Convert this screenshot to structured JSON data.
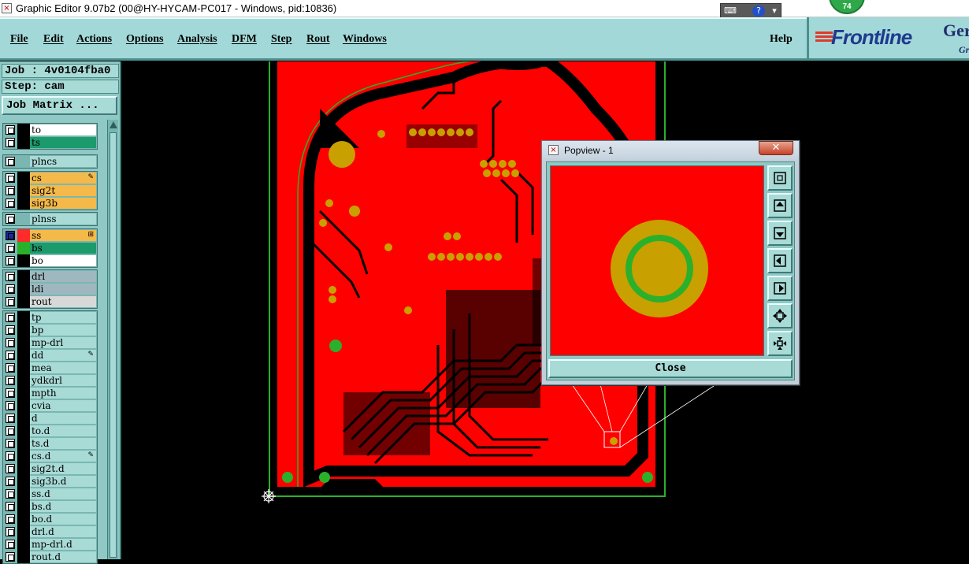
{
  "window": {
    "title": "Graphic Editor 9.07b2 (00@HY-HYCAM-PC017 - Windows, pid:10836)",
    "app_icon": "x-app-icon",
    "tray_icons": [
      "keyboard-icon",
      "help-icon",
      "dropdown-icon"
    ],
    "badge": "74"
  },
  "menu": {
    "items": [
      "File",
      "Edit",
      "Actions",
      "Options",
      "Analysis",
      "DFM",
      "Step",
      "Rout",
      "Windows"
    ],
    "help": "Help"
  },
  "logo": {
    "brand": "Frontline",
    "suffix_top": "Ger",
    "suffix_bottom": "Gr"
  },
  "job": {
    "job_label": "Job : 4v0104fba0",
    "step_label": "Step: cam",
    "matrix_button": "Job Matrix ..."
  },
  "layer_groups": [
    {
      "layers": [
        {
          "name": "to",
          "color": "#ffffff",
          "swatch": "#000000"
        },
        {
          "name": "ts",
          "color": "#1b9b6b",
          "swatch": "#000000"
        }
      ]
    },
    {
      "layers": [
        {
          "name": "plncs",
          "color": "#a8dad6",
          "swatch": "#7ab7b2"
        }
      ]
    },
    {
      "layers": [
        {
          "name": "cs",
          "color": "#f5b94a",
          "swatch": "#000000",
          "mark": "✎"
        },
        {
          "name": "sig2t",
          "color": "#f5b94a",
          "swatch": "#000000"
        },
        {
          "name": "sig3b",
          "color": "#f5b94a",
          "swatch": "#000000"
        }
      ]
    },
    {
      "layers": [
        {
          "name": "plnss",
          "color": "#a8dad6",
          "swatch": "#7ab7b2"
        }
      ]
    },
    {
      "layers": [
        {
          "name": "ss",
          "color": "#f5b94a",
          "swatch": "#ff2a2a",
          "mark": "⊞",
          "active": true
        },
        {
          "name": "bs",
          "color": "#1b9b6b",
          "swatch": "#2bb02b"
        },
        {
          "name": "bo",
          "color": "#ffffff",
          "swatch": "#000000"
        }
      ]
    },
    {
      "layers": [
        {
          "name": "drl",
          "color": "#9fb8c0",
          "swatch": "#000000"
        },
        {
          "name": "ldi",
          "color": "#9fb8c0",
          "swatch": "#000000"
        },
        {
          "name": "rout",
          "color": "#d8d8d8",
          "swatch": "#000000"
        }
      ]
    },
    {
      "layers": [
        {
          "name": "tp",
          "color": "#a8dad6",
          "swatch": "#000000"
        },
        {
          "name": "bp",
          "color": "#a8dad6",
          "swatch": "#000000"
        },
        {
          "name": "mp-drl",
          "color": "#a8dad6",
          "swatch": "#000000"
        },
        {
          "name": "dd",
          "color": "#a8dad6",
          "swatch": "#000000",
          "mark": "✎"
        },
        {
          "name": "mea",
          "color": "#a8dad6",
          "swatch": "#000000"
        },
        {
          "name": "ydkdrl",
          "color": "#a8dad6",
          "swatch": "#000000"
        },
        {
          "name": "mpth",
          "color": "#a8dad6",
          "swatch": "#000000"
        },
        {
          "name": "cvia",
          "color": "#a8dad6",
          "swatch": "#000000"
        },
        {
          "name": "d",
          "color": "#a8dad6",
          "swatch": "#000000"
        },
        {
          "name": "to.d",
          "color": "#a8dad6",
          "swatch": "#000000"
        },
        {
          "name": "ts.d",
          "color": "#a8dad6",
          "swatch": "#000000"
        },
        {
          "name": "cs.d",
          "color": "#a8dad6",
          "swatch": "#000000",
          "mark": "✎"
        },
        {
          "name": "sig2t.d",
          "color": "#a8dad6",
          "swatch": "#000000"
        },
        {
          "name": "sig3b.d",
          "color": "#a8dad6",
          "swatch": "#000000"
        },
        {
          "name": "ss.d",
          "color": "#a8dad6",
          "swatch": "#000000"
        },
        {
          "name": "bs.d",
          "color": "#a8dad6",
          "swatch": "#000000"
        },
        {
          "name": "bo.d",
          "color": "#a8dad6",
          "swatch": "#000000"
        },
        {
          "name": "drl.d",
          "color": "#a8dad6",
          "swatch": "#000000"
        },
        {
          "name": "mp-drl.d",
          "color": "#a8dad6",
          "swatch": "#000000"
        },
        {
          "name": "rout.d",
          "color": "#a8dad6",
          "swatch": "#000000"
        }
      ]
    }
  ],
  "board_colors": {
    "copper": "#ff0000",
    "outline": "#2bb02b",
    "pad": "#c8a000",
    "background": "#000000"
  },
  "popview": {
    "title": "Popview - 1",
    "close_glyph": "✕",
    "close_button": "Close",
    "tools": [
      "zoom-fit-icon",
      "pan-up-icon",
      "pan-down-icon",
      "pan-left-icon",
      "pan-right-icon",
      "zoom-out-icon",
      "zoom-in-icon"
    ]
  }
}
